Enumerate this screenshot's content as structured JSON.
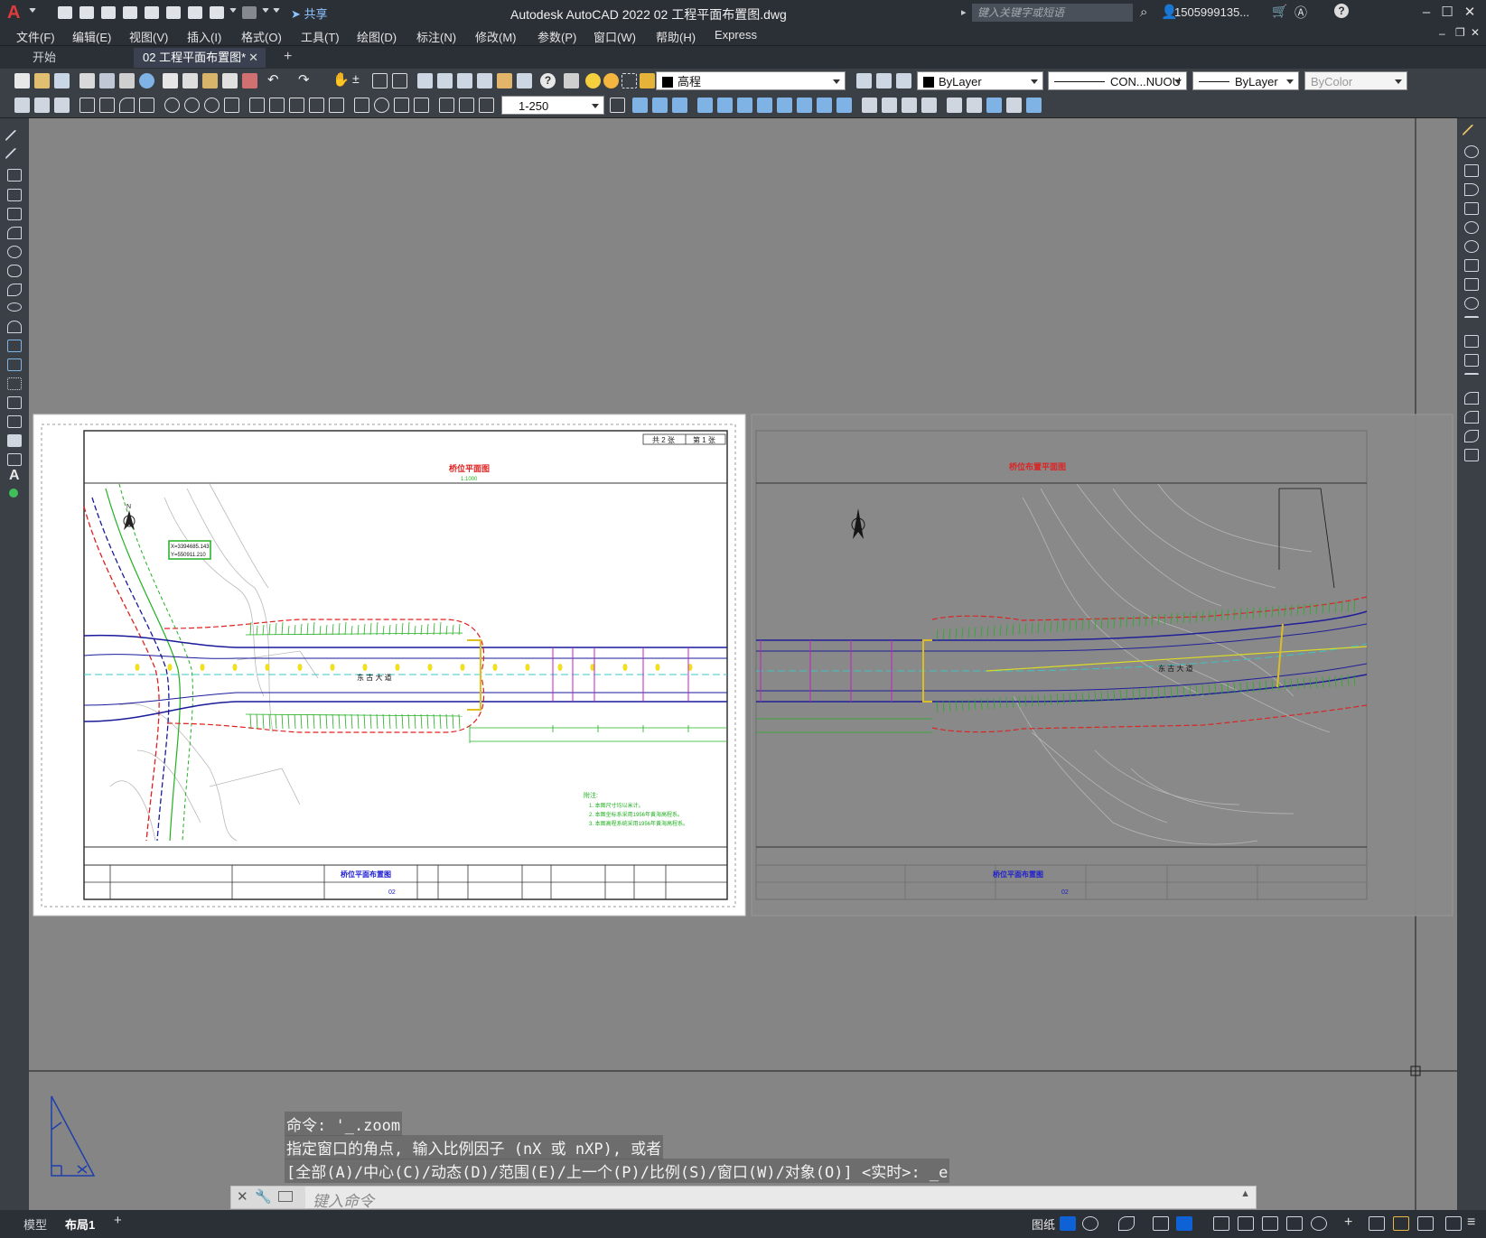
{
  "app": {
    "logo": "A",
    "share_label": "共享",
    "window_title": "Autodesk AutoCAD 2022    02  工程平面布置图.dwg",
    "search_placeholder": "键入关键字或短语",
    "user": "1505999135...",
    "win_min": "–",
    "win_max": "☐",
    "win_close": "✕"
  },
  "menubar": [
    "文件(F)",
    "编辑(E)",
    "视图(V)",
    "插入(I)",
    "格式(O)",
    "工具(T)",
    "绘图(D)",
    "标注(N)",
    "修改(M)",
    "参数(P)",
    "窗口(W)",
    "帮助(H)",
    "Express"
  ],
  "tabs": {
    "start": "开始",
    "document": "02  工程平面布置图*",
    "close": "✕",
    "add": "+"
  },
  "toolbar": {
    "layer_name": "高程",
    "color": "ByLayer",
    "linetype": "CON...NUOU",
    "lineweight": "ByLayer",
    "plotstyle": "ByColor",
    "scale": "1-250"
  },
  "drawing": {
    "sheet_left": {
      "page_count": "共 2 张",
      "page_no": "第 1 张",
      "plan_title": "桥位平面图",
      "scale_note": "1:1000",
      "road_name": "东 古 大 道",
      "north_label": "N",
      "coord_x": "X=3394685.143",
      "coord_y": "Y=550911.210",
      "note_title": "附注:",
      "notes": [
        "1. 本图尺寸均以米计。",
        "2. 本图坐标系采用1956年黄海高程系。",
        "3. 本图高程系统采用1956年黄海高程系。"
      ],
      "titleblock_name": "桥位平面布置图",
      "drawing_no": "02"
    },
    "sheet_right": {
      "plan_title": "桥位布置平面图",
      "road_name": "东 古 大 道",
      "titleblock_name": "桥位平面布置图",
      "drawing_no": "02"
    }
  },
  "command": {
    "history": [
      "命令: '_.zoom",
      "指定窗口的角点, 输入比例因子 (nX 或 nXP), 或者",
      "[全部(A)/中心(C)/动态(D)/范围(E)/上一个(P)/比例(S)/窗口(W)/对象(O)] <实时>: _e"
    ],
    "placeholder": "键入命令"
  },
  "statusbar": {
    "model_tab": "模型",
    "layout_tab": "布局1",
    "add_tab": "+",
    "paper_label": "图纸"
  },
  "colors": {
    "chrome": "#2b2f36",
    "toolbar": "#3b3f46",
    "canvas": "#858585",
    "accent": "#0f62d6"
  }
}
